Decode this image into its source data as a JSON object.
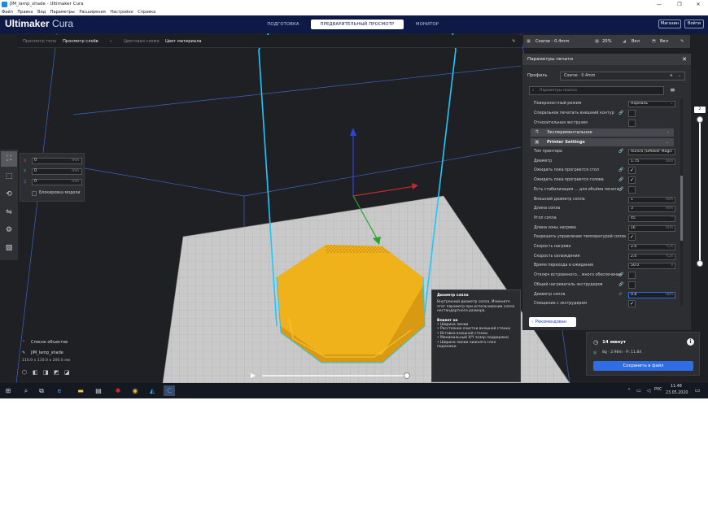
{
  "window": {
    "title": "JIM_lamp_shade - Ultimaker Cura"
  },
  "menu": [
    "Файл",
    "Правка",
    "Вид",
    "Параметры",
    "Расширения",
    "Настройки",
    "Справка"
  ],
  "header": {
    "logo_bold": "Ultimaker",
    "logo_light": " Cura",
    "stages": [
      "ПОДГОТОВКА",
      "ПРЕДВАРИТЕЛЬНЫЙ ПРОСМОТР",
      "МОНИТОР"
    ],
    "active_stage": 1,
    "marketplace": "Магазин",
    "signin": "Войти"
  },
  "viewbar": {
    "body_view": "Просмотр тела",
    "layer_view": "Просмотр слоёв",
    "color_scheme_label": "Цветовая схема",
    "color_scheme_value": "Цвет материала"
  },
  "settingsbar": {
    "profile": "Coarse - 0.4mm",
    "infill": "20%",
    "support": "Вкл",
    "adhesion": "Вкл"
  },
  "move_panel": {
    "x_label": "X",
    "x_value": "0",
    "y_label": "Y",
    "y_value": "0",
    "z_label": "Z",
    "z_value": "0",
    "unit": "mm",
    "lock_label": "Блокировка модели"
  },
  "print_panel": {
    "title": "Параметры печати",
    "profile_label": "Профиль",
    "profile_value": "Coarse - 0.4mm",
    "search_placeholder": "Параметры поиска",
    "rows": [
      {
        "label": "Поверхностный режим",
        "type": "select",
        "value": "Нормаль"
      },
      {
        "label": "Спиральное печатать внешний контур",
        "type": "check",
        "checked": false,
        "link": true
      },
      {
        "label": "Относительная экструзия",
        "type": "check",
        "checked": false
      }
    ],
    "cat_experimental": "Экспериментальное",
    "cat_printer": "Printer Settings",
    "printer_rows": [
      {
        "label": "Тип принтера",
        "type": "text",
        "value": "Aurora (GMaker Magic",
        "unit": "",
        "link": true
      },
      {
        "label": "Диаметр",
        "type": "text",
        "value": "1.75",
        "unit": "mm"
      },
      {
        "label": "Ожидать пока прогреется стол",
        "type": "check",
        "checked": true,
        "link": true
      },
      {
        "label": "Ожидать пока прогреется голова",
        "type": "check",
        "checked": true,
        "link": true
      },
      {
        "label": "Есть стабилизация ... для объёма печати",
        "type": "check",
        "checked": false,
        "link": true
      },
      {
        "label": "Внешний диаметр сопла",
        "type": "text",
        "value": "1",
        "unit": "mm"
      },
      {
        "label": "Длина сопла",
        "type": "text",
        "value": "3",
        "unit": "mm"
      },
      {
        "label": "Угол сопла",
        "type": "text",
        "value": "45",
        "unit": "°"
      },
      {
        "label": "Длина зоны нагрева",
        "type": "text",
        "value": "16",
        "unit": "mm"
      },
      {
        "label": "Разрешить управление температурой сопла",
        "type": "check",
        "checked": true
      },
      {
        "label": "Скорость нагрева",
        "type": "text",
        "value": "2.0",
        "unit": "°C/s"
      },
      {
        "label": "Скорость охлаждения",
        "type": "text",
        "value": "2.0",
        "unit": "°C/s"
      },
      {
        "label": "Время перехода в ожидание",
        "type": "text",
        "value": "50.0",
        "unit": "s"
      },
      {
        "label": "Отключ встроенного... много обеспечение",
        "type": "check",
        "checked": false,
        "link": true
      },
      {
        "label": "Общий нагреватель экструдеров",
        "type": "check",
        "checked": false,
        "link": true
      },
      {
        "label": "Диаметр сопла",
        "type": "text",
        "value": "0.8",
        "unit": "mm",
        "reset": true
      },
      {
        "label": "Смещение с экструдером",
        "type": "check",
        "checked": true
      }
    ],
    "recommended_button": "Рекомендован"
  },
  "tooltip": {
    "title": "Диаметр сопла",
    "description": "Внутренний диаметр сопла. Измените этот параметр при использовании сопла нестандартного размера.",
    "affects_label": "Влияет на",
    "affects": [
      "Ширина линии",
      "Расстояние очистки внешней стенки",
      "Вставка внешней стенки",
      "Минимальный X/Y зазор поддержки",
      "Ширина линии нижнего слоя подложки"
    ]
  },
  "output": {
    "time": "14 минут",
    "material": "8g · 2.98m · P: 11.84",
    "save_button": "Сохранить в файл"
  },
  "objects": {
    "list_label": "Список объектов",
    "file_name": "JIM_lamp_shade",
    "dimensions": "110.0 x 110.0 x 200.0 мм"
  },
  "layer_slider": {
    "top_value": "2"
  },
  "taskbar": {
    "lang": "РУС",
    "time": "11:48",
    "date": "23.05.2020"
  },
  "colors": {
    "header": "#0e1a45",
    "accent": "#2e6de3",
    "model": "#f0b21a",
    "outline": "#1ec8ff"
  }
}
